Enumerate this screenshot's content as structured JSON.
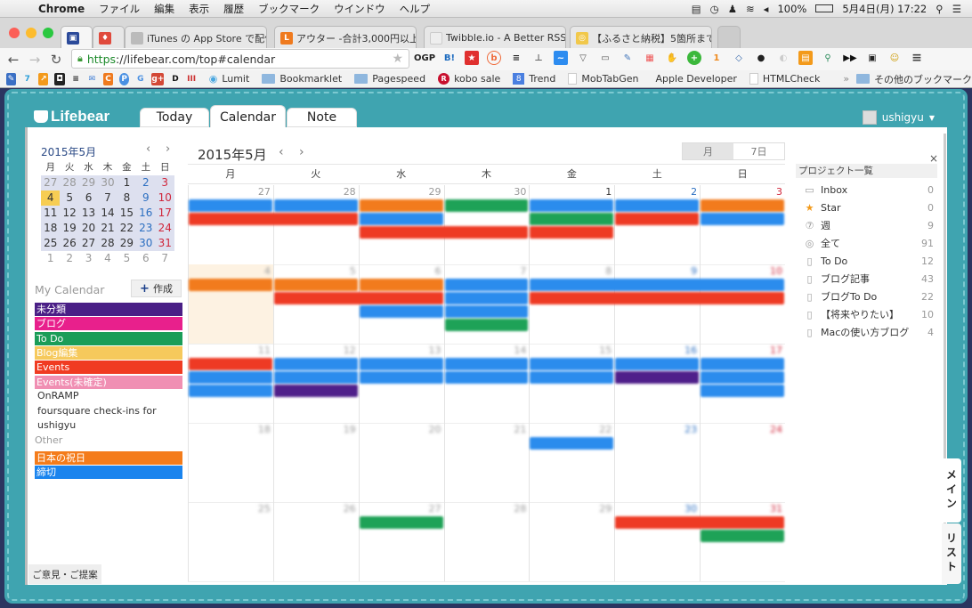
{
  "menubar": {
    "app": "Chrome",
    "menus": [
      "ファイル",
      "編集",
      "表示",
      "履歴",
      "ブックマーク",
      "ウインドウ",
      "ヘルプ"
    ],
    "battery": "100%",
    "datetime": "5月4日(月) 17:22"
  },
  "tabs": [
    {
      "title": "",
      "favicon_color": "#2b4a9a"
    },
    {
      "title": "",
      "favicon_color": "#e04a3c"
    },
    {
      "title": "iTunes の App Store で配信",
      "favicon_color": "#bbbbbb"
    },
    {
      "title": "アウター -合計3,000円以上",
      "favicon_color": "#ef7a1e"
    },
    {
      "title": "Twibble.io - A Better RSS",
      "favicon_color": "#dddddd"
    },
    {
      "title": "【ふるさと納税】5箇所まで",
      "favicon_color": "#f1c84b"
    }
  ],
  "address": {
    "scheme": "https",
    "rest": "://lifebear.com/top#calendar"
  },
  "extensions": [
    "OGP",
    "B!",
    "★",
    "b",
    "≡",
    "⊥",
    "~",
    "▽",
    "▭",
    "✎",
    "▦",
    "✋",
    "+",
    "1",
    "◇",
    "●",
    "◐",
    "▤",
    "⚲",
    "▶▶",
    "▣",
    "☺",
    "≡"
  ],
  "bookmarks": [
    {
      "label": "Lumit",
      "type": "link"
    },
    {
      "label": "Bookmarklet",
      "type": "folder"
    },
    {
      "label": "Pagespeed",
      "type": "folder"
    },
    {
      "label": "kobo sale",
      "type": "link"
    },
    {
      "label": "Trend",
      "type": "link"
    },
    {
      "label": "MobTabGen",
      "type": "page"
    },
    {
      "label": "Apple Developer",
      "type": "link"
    },
    {
      "label": "HTMLCheck",
      "type": "page"
    },
    {
      "label": "その他のブックマーク",
      "type": "folder"
    }
  ],
  "bookmarks_overflow": "»",
  "app": {
    "logo": "Lifebear",
    "tabs": [
      "Today",
      "Calendar",
      "Note"
    ],
    "active_tab": "Calendar",
    "user": "ushigyu"
  },
  "mini_calendar": {
    "title": "2015年5月",
    "prev": "‹",
    "next": "›",
    "weekdays": [
      "月",
      "火",
      "水",
      "木",
      "金",
      "土",
      "日"
    ],
    "weeks": [
      [
        "27",
        "28",
        "29",
        "30",
        "1",
        "2",
        "3"
      ],
      [
        "4",
        "5",
        "6",
        "7",
        "8",
        "9",
        "10"
      ],
      [
        "11",
        "12",
        "13",
        "14",
        "15",
        "16",
        "17"
      ],
      [
        "18",
        "19",
        "20",
        "21",
        "22",
        "23",
        "24"
      ],
      [
        "25",
        "26",
        "27",
        "28",
        "29",
        "30",
        "31"
      ],
      [
        "1",
        "2",
        "3",
        "4",
        "5",
        "6",
        "7"
      ]
    ],
    "today": "4"
  },
  "my_calendar": {
    "title": "My Calendar",
    "create_label": "作成",
    "items": [
      {
        "label": "未分類",
        "color": "#4a1f86"
      },
      {
        "label": "ブログ",
        "color": "#e8208c"
      },
      {
        "label": "To Do",
        "color": "#1a9d58"
      },
      {
        "label": "Blog編集",
        "color": "#f6c95c"
      },
      {
        "label": "Events",
        "color": "#f03b22"
      },
      {
        "label": "Events(未確定)",
        "color": "#f08fb3"
      }
    ],
    "plain_items": [
      "OnRAMP",
      "foursquare check-ins for",
      "ushigyu"
    ],
    "other_title": "Other",
    "other_items": [
      {
        "label": "日本の祝日",
        "color": "#f47c1b"
      },
      {
        "label": "締切",
        "color": "#1a84ee"
      }
    ]
  },
  "feedback_label": "ご意見・ご提案",
  "main_calendar": {
    "title": "2015年5月",
    "prev": "‹",
    "next": "›",
    "views": [
      "月",
      "7日"
    ],
    "active_view": "月",
    "weekdays": [
      "月",
      "火",
      "水",
      "木",
      "金",
      "土",
      "日"
    ],
    "weeks": [
      [
        "27",
        "28",
        "29",
        "30",
        "1",
        "2",
        "3"
      ],
      [
        "4",
        "5",
        "6",
        "7",
        "8",
        "9",
        "10"
      ],
      [
        "11",
        "12",
        "13",
        "14",
        "15",
        "16",
        "17"
      ],
      [
        "18",
        "19",
        "20",
        "21",
        "22",
        "23",
        "24"
      ],
      [
        "25",
        "26",
        "27",
        "28",
        "29",
        "30",
        "31"
      ]
    ]
  },
  "projects": {
    "title": "プロジェクト一覧",
    "close": "×",
    "items": [
      {
        "label": "Inbox",
        "count": "0",
        "icon": "inbox-icon"
      },
      {
        "label": "Star",
        "count": "0",
        "icon": "star-icon"
      },
      {
        "label": "週",
        "count": "9",
        "icon": "calendar-icon"
      },
      {
        "label": "全て",
        "count": "91",
        "icon": "all-icon"
      },
      {
        "label": "To Do",
        "count": "12",
        "icon": "document-icon"
      },
      {
        "label": "ブログ記事",
        "count": "43",
        "icon": "document-icon"
      },
      {
        "label": "ブログTo Do",
        "count": "22",
        "icon": "document-icon"
      },
      {
        "label": "【将来やりたい】",
        "count": "10",
        "icon": "document-icon"
      },
      {
        "label": "Macの使い方ブログ",
        "count": "4",
        "icon": "document-icon"
      }
    ]
  },
  "side_tabs": [
    "メイン",
    "リスト"
  ]
}
